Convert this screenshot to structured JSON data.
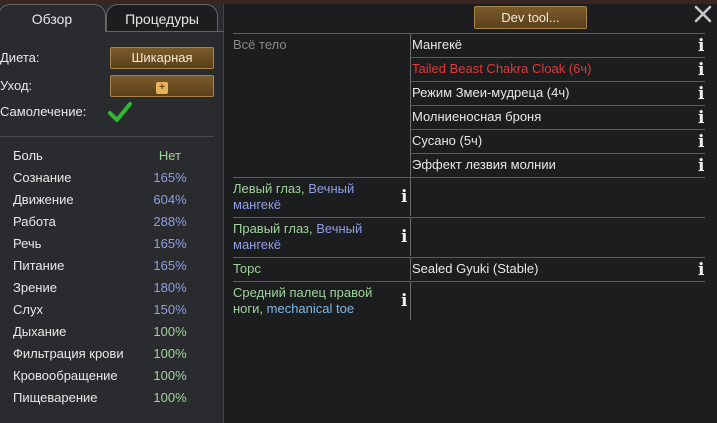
{
  "tabs": {
    "overview": "Обзор",
    "operations": "Процедуры"
  },
  "settings": {
    "diet_label": "Диета:",
    "diet_value": "Шикарная",
    "care_label": "Уход:",
    "self_treat_label": "Самолечение:",
    "self_treat_enabled": true
  },
  "capacities": [
    {
      "name": "Боль",
      "value": "Нет",
      "color": "#9fd39c"
    },
    {
      "name": "Сознание",
      "value": "165%",
      "color": "#8f9fe6"
    },
    {
      "name": "Движение",
      "value": "604%",
      "color": "#8f9fe6"
    },
    {
      "name": "Работа",
      "value": "288%",
      "color": "#8f9fe6"
    },
    {
      "name": "Речь",
      "value": "165%",
      "color": "#8f9fe6"
    },
    {
      "name": "Питание",
      "value": "165%",
      "color": "#8f9fe6"
    },
    {
      "name": "Зрение",
      "value": "180%",
      "color": "#8f9fe6"
    },
    {
      "name": "Слух",
      "value": "150%",
      "color": "#8f9fe6"
    },
    {
      "name": "Дыхание",
      "value": "100%",
      "color": "#9fd39c"
    },
    {
      "name": "Фильтрация крови",
      "value": "100%",
      "color": "#9fd39c"
    },
    {
      "name": "Кровообращение",
      "value": "100%",
      "color": "#9fd39c"
    },
    {
      "name": "Пищеварение",
      "value": "100%",
      "color": "#9fd39c"
    }
  ],
  "dev_tool_label": "Dev tool...",
  "health": {
    "whole_body": {
      "label": "Всё тело",
      "items": [
        {
          "text": "Мангекё",
          "color": "#e8e8e8"
        },
        {
          "text": "Tailed Beast Chakra Cloak (6ч)",
          "color": "#e23a3a"
        },
        {
          "text": "Режим Змеи-мудреца (4ч)",
          "color": "#e8e8e8"
        },
        {
          "text": "Молниеносная броня",
          "color": "#e8e8e8"
        },
        {
          "text": "Сусано (5ч)",
          "color": "#e8e8e8"
        },
        {
          "text": "Эффект лезвия молнии",
          "color": "#e8e8e8"
        }
      ]
    },
    "left_eye": {
      "part": "Левый глаз, ",
      "part2": "Вечный мангекё"
    },
    "right_eye": {
      "part": "Правый глаз, ",
      "part2": "Вечный мангекё"
    },
    "torso": {
      "label": "Торс",
      "item": "Sealed Gyuki (Stable)"
    },
    "toe": {
      "part": "Средний палец правой ноги, ",
      "part2": "mechanical toe"
    }
  },
  "info_glyph": "i"
}
